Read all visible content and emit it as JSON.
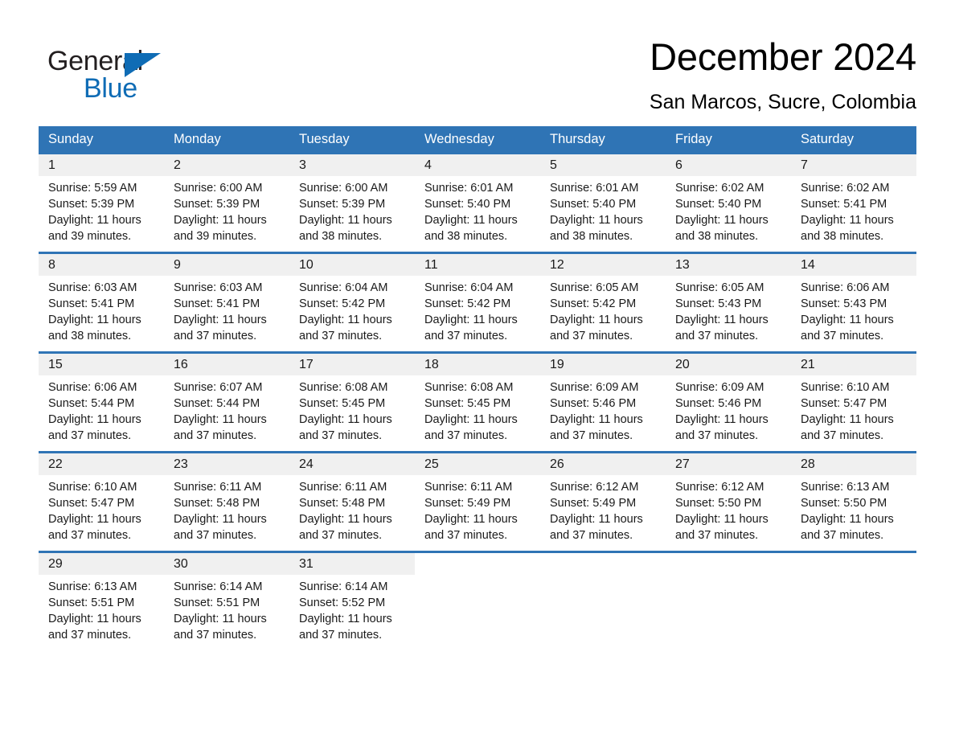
{
  "brand": {
    "logo_text_1": "General",
    "logo_text_2": "Blue",
    "logo_icon": "triangle-flag-icon",
    "accent_color": "#0f6cb5"
  },
  "header": {
    "title": "December 2024",
    "location": "San Marcos, Sucre, Colombia"
  },
  "theme": {
    "header_blue": "#2f74b5",
    "daynum_band": "#f0f0f0",
    "text": "#1a1a1a"
  },
  "calendar": {
    "weekdays": [
      "Sunday",
      "Monday",
      "Tuesday",
      "Wednesday",
      "Thursday",
      "Friday",
      "Saturday"
    ],
    "weeks": [
      {
        "days": [
          {
            "num": "1",
            "sunrise": "Sunrise: 5:59 AM",
            "sunset": "Sunset: 5:39 PM",
            "daylight1": "Daylight: 11 hours",
            "daylight2": "and 39 minutes."
          },
          {
            "num": "2",
            "sunrise": "Sunrise: 6:00 AM",
            "sunset": "Sunset: 5:39 PM",
            "daylight1": "Daylight: 11 hours",
            "daylight2": "and 39 minutes."
          },
          {
            "num": "3",
            "sunrise": "Sunrise: 6:00 AM",
            "sunset": "Sunset: 5:39 PM",
            "daylight1": "Daylight: 11 hours",
            "daylight2": "and 38 minutes."
          },
          {
            "num": "4",
            "sunrise": "Sunrise: 6:01 AM",
            "sunset": "Sunset: 5:40 PM",
            "daylight1": "Daylight: 11 hours",
            "daylight2": "and 38 minutes."
          },
          {
            "num": "5",
            "sunrise": "Sunrise: 6:01 AM",
            "sunset": "Sunset: 5:40 PM",
            "daylight1": "Daylight: 11 hours",
            "daylight2": "and 38 minutes."
          },
          {
            "num": "6",
            "sunrise": "Sunrise: 6:02 AM",
            "sunset": "Sunset: 5:40 PM",
            "daylight1": "Daylight: 11 hours",
            "daylight2": "and 38 minutes."
          },
          {
            "num": "7",
            "sunrise": "Sunrise: 6:02 AM",
            "sunset": "Sunset: 5:41 PM",
            "daylight1": "Daylight: 11 hours",
            "daylight2": "and 38 minutes."
          }
        ]
      },
      {
        "days": [
          {
            "num": "8",
            "sunrise": "Sunrise: 6:03 AM",
            "sunset": "Sunset: 5:41 PM",
            "daylight1": "Daylight: 11 hours",
            "daylight2": "and 38 minutes."
          },
          {
            "num": "9",
            "sunrise": "Sunrise: 6:03 AM",
            "sunset": "Sunset: 5:41 PM",
            "daylight1": "Daylight: 11 hours",
            "daylight2": "and 37 minutes."
          },
          {
            "num": "10",
            "sunrise": "Sunrise: 6:04 AM",
            "sunset": "Sunset: 5:42 PM",
            "daylight1": "Daylight: 11 hours",
            "daylight2": "and 37 minutes."
          },
          {
            "num": "11",
            "sunrise": "Sunrise: 6:04 AM",
            "sunset": "Sunset: 5:42 PM",
            "daylight1": "Daylight: 11 hours",
            "daylight2": "and 37 minutes."
          },
          {
            "num": "12",
            "sunrise": "Sunrise: 6:05 AM",
            "sunset": "Sunset: 5:42 PM",
            "daylight1": "Daylight: 11 hours",
            "daylight2": "and 37 minutes."
          },
          {
            "num": "13",
            "sunrise": "Sunrise: 6:05 AM",
            "sunset": "Sunset: 5:43 PM",
            "daylight1": "Daylight: 11 hours",
            "daylight2": "and 37 minutes."
          },
          {
            "num": "14",
            "sunrise": "Sunrise: 6:06 AM",
            "sunset": "Sunset: 5:43 PM",
            "daylight1": "Daylight: 11 hours",
            "daylight2": "and 37 minutes."
          }
        ]
      },
      {
        "days": [
          {
            "num": "15",
            "sunrise": "Sunrise: 6:06 AM",
            "sunset": "Sunset: 5:44 PM",
            "daylight1": "Daylight: 11 hours",
            "daylight2": "and 37 minutes."
          },
          {
            "num": "16",
            "sunrise": "Sunrise: 6:07 AM",
            "sunset": "Sunset: 5:44 PM",
            "daylight1": "Daylight: 11 hours",
            "daylight2": "and 37 minutes."
          },
          {
            "num": "17",
            "sunrise": "Sunrise: 6:08 AM",
            "sunset": "Sunset: 5:45 PM",
            "daylight1": "Daylight: 11 hours",
            "daylight2": "and 37 minutes."
          },
          {
            "num": "18",
            "sunrise": "Sunrise: 6:08 AM",
            "sunset": "Sunset: 5:45 PM",
            "daylight1": "Daylight: 11 hours",
            "daylight2": "and 37 minutes."
          },
          {
            "num": "19",
            "sunrise": "Sunrise: 6:09 AM",
            "sunset": "Sunset: 5:46 PM",
            "daylight1": "Daylight: 11 hours",
            "daylight2": "and 37 minutes."
          },
          {
            "num": "20",
            "sunrise": "Sunrise: 6:09 AM",
            "sunset": "Sunset: 5:46 PM",
            "daylight1": "Daylight: 11 hours",
            "daylight2": "and 37 minutes."
          },
          {
            "num": "21",
            "sunrise": "Sunrise: 6:10 AM",
            "sunset": "Sunset: 5:47 PM",
            "daylight1": "Daylight: 11 hours",
            "daylight2": "and 37 minutes."
          }
        ]
      },
      {
        "days": [
          {
            "num": "22",
            "sunrise": "Sunrise: 6:10 AM",
            "sunset": "Sunset: 5:47 PM",
            "daylight1": "Daylight: 11 hours",
            "daylight2": "and 37 minutes."
          },
          {
            "num": "23",
            "sunrise": "Sunrise: 6:11 AM",
            "sunset": "Sunset: 5:48 PM",
            "daylight1": "Daylight: 11 hours",
            "daylight2": "and 37 minutes."
          },
          {
            "num": "24",
            "sunrise": "Sunrise: 6:11 AM",
            "sunset": "Sunset: 5:48 PM",
            "daylight1": "Daylight: 11 hours",
            "daylight2": "and 37 minutes."
          },
          {
            "num": "25",
            "sunrise": "Sunrise: 6:11 AM",
            "sunset": "Sunset: 5:49 PM",
            "daylight1": "Daylight: 11 hours",
            "daylight2": "and 37 minutes."
          },
          {
            "num": "26",
            "sunrise": "Sunrise: 6:12 AM",
            "sunset": "Sunset: 5:49 PM",
            "daylight1": "Daylight: 11 hours",
            "daylight2": "and 37 minutes."
          },
          {
            "num": "27",
            "sunrise": "Sunrise: 6:12 AM",
            "sunset": "Sunset: 5:50 PM",
            "daylight1": "Daylight: 11 hours",
            "daylight2": "and 37 minutes."
          },
          {
            "num": "28",
            "sunrise": "Sunrise: 6:13 AM",
            "sunset": "Sunset: 5:50 PM",
            "daylight1": "Daylight: 11 hours",
            "daylight2": "and 37 minutes."
          }
        ]
      },
      {
        "days": [
          {
            "num": "29",
            "sunrise": "Sunrise: 6:13 AM",
            "sunset": "Sunset: 5:51 PM",
            "daylight1": "Daylight: 11 hours",
            "daylight2": "and 37 minutes."
          },
          {
            "num": "30",
            "sunrise": "Sunrise: 6:14 AM",
            "sunset": "Sunset: 5:51 PM",
            "daylight1": "Daylight: 11 hours",
            "daylight2": "and 37 minutes."
          },
          {
            "num": "31",
            "sunrise": "Sunrise: 6:14 AM",
            "sunset": "Sunset: 5:52 PM",
            "daylight1": "Daylight: 11 hours",
            "daylight2": "and 37 minutes."
          },
          {
            "num": "",
            "sunrise": "",
            "sunset": "",
            "daylight1": "",
            "daylight2": ""
          },
          {
            "num": "",
            "sunrise": "",
            "sunset": "",
            "daylight1": "",
            "daylight2": ""
          },
          {
            "num": "",
            "sunrise": "",
            "sunset": "",
            "daylight1": "",
            "daylight2": ""
          },
          {
            "num": "",
            "sunrise": "",
            "sunset": "",
            "daylight1": "",
            "daylight2": ""
          }
        ]
      }
    ]
  }
}
